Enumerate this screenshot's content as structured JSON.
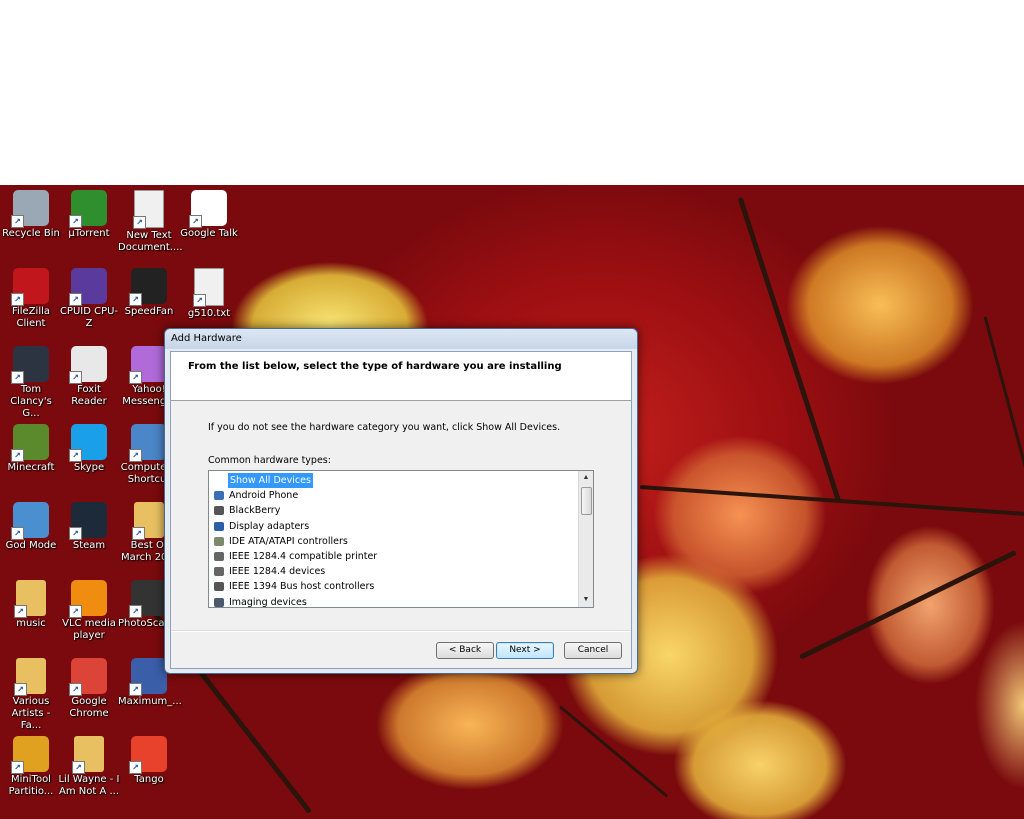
{
  "desktop_icons": [
    {
      "label": "Recycle Bin",
      "icon": "recycle-bin-icon",
      "color": "#9aa7b4"
    },
    {
      "label": "µTorrent",
      "icon": "utorrent-icon",
      "color": "#2f8f2f"
    },
    {
      "label": "New Text Document....",
      "icon": "text-document-icon",
      "color": "#f0f0f0"
    },
    {
      "label": "Google Talk",
      "icon": "google-talk-icon",
      "color": "#ffffff"
    },
    {
      "label": "FileZilla Client",
      "icon": "filezilla-icon",
      "color": "#c0161c"
    },
    {
      "label": "CPUID CPU-Z",
      "icon": "cpuz-icon",
      "color": "#5b3a9e"
    },
    {
      "label": "SpeedFan",
      "icon": "speedfan-icon",
      "color": "#222222"
    },
    {
      "label": "g510.txt",
      "icon": "text-document-icon",
      "color": "#f0f0f0"
    },
    {
      "label": "Tom Clancy's G...",
      "icon": "ghost-recon-icon",
      "color": "#2b3440"
    },
    {
      "label": "Foxit Reader",
      "icon": "foxit-reader-icon",
      "color": "#e8e8e8"
    },
    {
      "label": "Yahoo! Messeng...",
      "icon": "yahoo-messenger-icon",
      "color": "#b06ad9"
    },
    {
      "label": "Minecraft",
      "icon": "minecraft-icon",
      "color": "#5a8a2c"
    },
    {
      "label": "Skype",
      "icon": "skype-icon",
      "color": "#1aa0e8"
    },
    {
      "label": "Computer - Shortcut",
      "icon": "computer-icon",
      "color": "#4a86c8"
    },
    {
      "label": "God Mode",
      "icon": "control-panel-icon",
      "color": "#4a8fd0"
    },
    {
      "label": "Steam",
      "icon": "steam-icon",
      "color": "#1c2a3a"
    },
    {
      "label": "Best Of March 20...",
      "icon": "folder-icon",
      "color": "#e8c062"
    },
    {
      "label": "music",
      "icon": "folder-icon",
      "color": "#e8c062"
    },
    {
      "label": "VLC media player",
      "icon": "vlc-icon",
      "color": "#f08c10"
    },
    {
      "label": "PhotoScap...",
      "icon": "photoscape-icon",
      "color": "#333333"
    },
    {
      "label": "Various Artists - Fa...",
      "icon": "folder-icon",
      "color": "#e8c062"
    },
    {
      "label": "Google Chrome",
      "icon": "chrome-icon",
      "color": "#db4437"
    },
    {
      "label": "Maximum_...",
      "icon": "magazine-icon",
      "color": "#3a5ea8"
    },
    {
      "label": "MiniTool Partitio...",
      "icon": "minitool-icon",
      "color": "#e0a020"
    },
    {
      "label": "Lil Wayne - I Am Not A ...",
      "icon": "folder-icon",
      "color": "#e8c062"
    },
    {
      "label": "Tango",
      "icon": "tango-icon",
      "color": "#e8412c"
    }
  ],
  "dialog": {
    "title": "Add Hardware",
    "header": "From the list below, select the type of hardware you are installing",
    "instruction": "If you do not see the hardware category you want, click Show All Devices.",
    "list_label": "Common hardware types:",
    "items": [
      {
        "label": "Show All Devices",
        "icon": "none",
        "selected": true
      },
      {
        "label": "Android Phone",
        "icon": "phone-device-icon",
        "selected": false
      },
      {
        "label": "BlackBerry",
        "icon": "usb-device-icon",
        "selected": false
      },
      {
        "label": "Display adapters",
        "icon": "display-adapter-icon",
        "selected": false
      },
      {
        "label": "IDE ATA/ATAPI controllers",
        "icon": "ide-controller-icon",
        "selected": false
      },
      {
        "label": "IEEE 1284.4 compatible printer",
        "icon": "printer-icon",
        "selected": false
      },
      {
        "label": "IEEE 1284.4 devices",
        "icon": "printer-icon",
        "selected": false
      },
      {
        "label": "IEEE 1394 Bus host controllers",
        "icon": "usb-device-icon",
        "selected": false
      },
      {
        "label": "Imaging devices",
        "icon": "scanner-icon",
        "selected": false
      }
    ],
    "buttons": {
      "back": "< Back",
      "next": "Next >",
      "cancel": "Cancel"
    }
  },
  "colors": {
    "selection": "#3399ff",
    "wallpaper": "#9d0f12"
  }
}
